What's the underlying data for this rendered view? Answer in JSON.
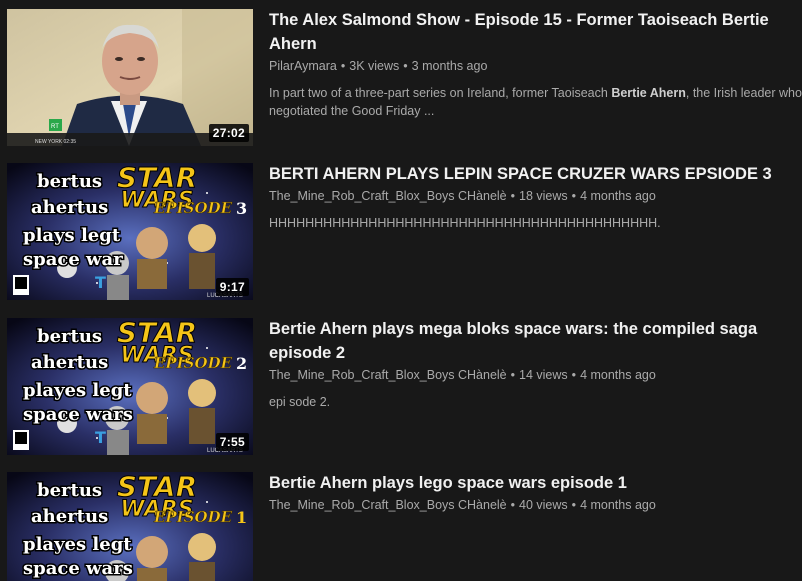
{
  "videos": [
    {
      "title": "The Alex Salmond Show - Episode 15 - Former Taoiseach Bertie Ahern",
      "channel": "PilarAymara",
      "views": "3K views",
      "age": "3 months ago",
      "description_pre": "In part two of a three-part series on Ireland, former Taoiseach ",
      "description_bold": "Bertie Ahern",
      "description_post": ", the Irish leader who",
      "description_line2": "negotiated the Good Friday ...",
      "duration": "27:02",
      "thumb_badge": "RT",
      "thumb_ticker": "NEW YORK 02:35"
    },
    {
      "title": "BERTI AHERN PLAYS LEPIN SPACE CRUZER WARS EPSIODE 3",
      "channel": "The_Mine_Rob_Craft_Blox_Boys CHànelè",
      "views": "18 views",
      "age": "4 months ago",
      "description": "HHHHHHHHHHHHHHHHHHHHHHHHHHHHHHHHHHHHHHHHHHH.",
      "duration": "9:17",
      "thumb_overlay": [
        "bertus",
        "ahertus",
        "plays legt",
        "space war"
      ],
      "thumb_logo_top": "STAR",
      "thumb_logo_bottom": "WARS",
      "thumb_episode": "EPISODE",
      "thumb_numeral": "3"
    },
    {
      "title": "Bertie Ahern plays mega bloks space wars: the compiled saga episode 2",
      "channel": "The_Mine_Rob_Craft_Blox_Boys CHànelè",
      "views": "14 views",
      "age": "4 months ago",
      "description": "epi sode 2.",
      "duration": "7:55",
      "thumb_overlay": [
        "bertus",
        "ahertus",
        "playes legt",
        "space wars"
      ],
      "thumb_logo_top": "STAR",
      "thumb_logo_bottom": "WARS",
      "thumb_episode": "EPISODE",
      "thumb_numeral": "2"
    },
    {
      "title": "Bertie Ahern plays lego space wars episode 1",
      "channel": "The_Mine_Rob_Craft_Blox_Boys CHànelè",
      "views": "40 views",
      "age": "4 months ago",
      "thumb_overlay": [
        "bertus",
        "ahertus",
        "playes legt",
        "space wars"
      ],
      "thumb_logo_top": "STAR",
      "thumb_logo_bottom": "WARS",
      "thumb_episode": "EPISODE",
      "thumb_numeral": "1"
    }
  ],
  "colors": {
    "background": "#181818",
    "title": "#f1f1f1",
    "meta": "#aaaaaa",
    "logo_yellow": "#f5c518"
  }
}
